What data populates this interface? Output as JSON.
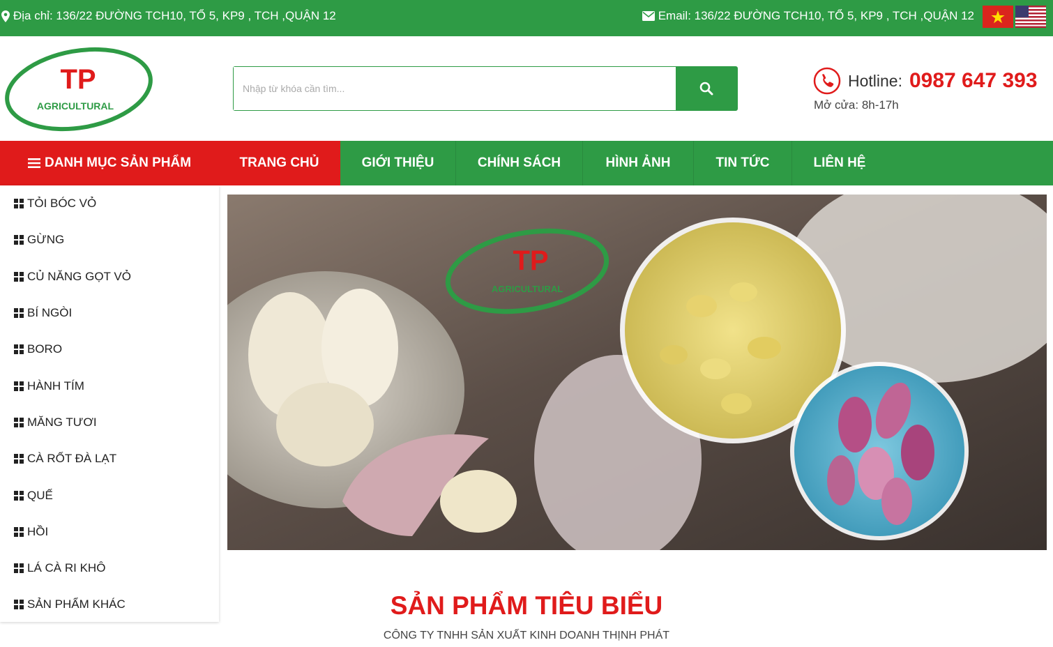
{
  "topbar": {
    "address": "Địa chỉ: 136/22 ĐƯỜNG TCH10, TỔ 5, KP9 , TCH ,QUẬN 12",
    "email": "Email: 136/22 ĐƯỜNG TCH10, TỔ 5, KP9 , TCH ,QUẬN 12",
    "flags": [
      "vietnam-flag-icon",
      "usa-flag-icon"
    ]
  },
  "logo": {
    "title": "TP",
    "subtitle": "AGRICULTURAL"
  },
  "search": {
    "placeholder": "Nhập từ khóa cần tìm...",
    "icon": "search-icon"
  },
  "hotline": {
    "label": "Hotline:",
    "number": "0987 647 393",
    "hours": "Mở cửa: 8h-17h",
    "icon": "phone-icon"
  },
  "nav": {
    "category_label": "DANH MỤC SẢN PHẨM",
    "items": [
      {
        "label": "TRANG CHỦ",
        "active": true
      },
      {
        "label": "GIỚI THIỆU",
        "active": false
      },
      {
        "label": "CHÍNH SÁCH",
        "active": false
      },
      {
        "label": "HÌNH ẢNH",
        "active": false
      },
      {
        "label": "TIN TỨC",
        "active": false
      },
      {
        "label": "LIÊN HỆ",
        "active": false
      }
    ]
  },
  "categories": [
    "TỎI BÓC VỎ",
    "GỪNG",
    "CỦ NĂNG GỌT VỎ",
    "BÍ NGÒI",
    "BORO",
    "HÀNH TÍM",
    "MĂNG TƯƠI",
    "CÀ RỐT ĐÀ LẠT",
    "QUẾ",
    "HỒI",
    "LÁ CÀ RI KHÔ",
    "SẢN PHẨM KHÁC"
  ],
  "banner": {
    "logo_title": "TP",
    "logo_subtitle": "AGRICULTURAL"
  },
  "featured": {
    "title": "SẢN PHẨM TIÊU BIỂU",
    "subtitle": "CÔNG TY TNHH SẢN XUẤT KINH DOANH THỊNH PHÁT"
  },
  "colors": {
    "green": "#2e9b45",
    "red": "#e01b1b"
  }
}
